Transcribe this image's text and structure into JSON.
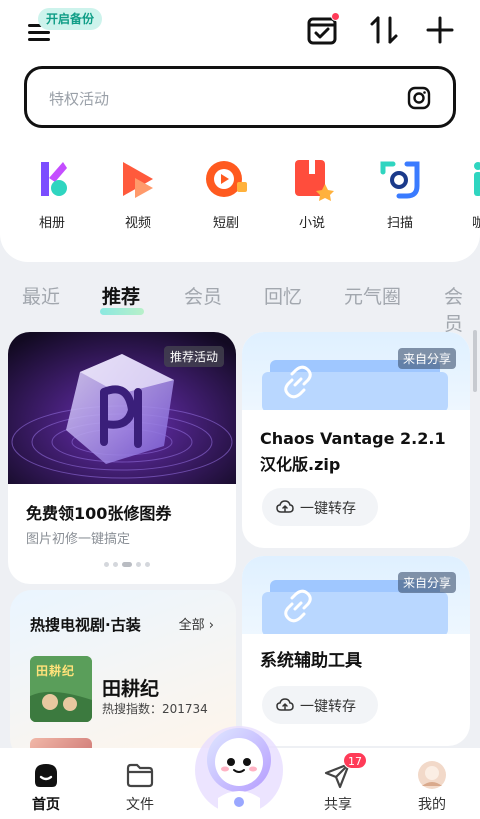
{
  "header": {
    "backup_label": "开启备份",
    "icons": [
      "menu-icon",
      "calendar-check-icon",
      "transfer-icon",
      "plus-icon"
    ]
  },
  "search": {
    "placeholder": "特权活动",
    "icon": "camera-icon"
  },
  "apps": [
    {
      "label": "相册",
      "icon": "album-icon"
    },
    {
      "label": "视频",
      "icon": "video-icon"
    },
    {
      "label": "短剧",
      "icon": "short-drama-icon"
    },
    {
      "label": "小说",
      "icon": "novel-icon"
    },
    {
      "label": "扫描",
      "icon": "scan-icon"
    },
    {
      "label": "咖",
      "icon": "partial-app-icon"
    }
  ],
  "tabs": [
    {
      "label": "最近"
    },
    {
      "label": "推荐"
    },
    {
      "label": "会员"
    },
    {
      "label": "回忆"
    },
    {
      "label": "元气圈"
    },
    {
      "label": "会员"
    }
  ],
  "feed": {
    "promo": {
      "tag": "推荐活动",
      "title": "免费领100张修图券",
      "subtitle": "图片初修一键搞定"
    },
    "share1": {
      "tag": "来自分享",
      "title": "Chaos Vantage 2.2.1 汉化版.zip",
      "button": "一键转存"
    },
    "share2": {
      "tag": "来自分享",
      "title": "系统辅助工具",
      "button": "一键转存"
    },
    "hot": {
      "title": "热搜电视剧·古装",
      "all_label": "全部",
      "drama_title": "田耕纪",
      "drama_index": "热搜指数：201734",
      "poster_text": "田耕纪"
    }
  },
  "nav": [
    {
      "label": "首页",
      "icon": "home-icon",
      "active": true
    },
    {
      "label": "文件",
      "icon": "folder-icon"
    },
    {
      "label": "共享",
      "icon": "send-icon",
      "badge": "17"
    },
    {
      "label": "我的",
      "icon": "avatar-icon"
    }
  ],
  "colors": {
    "accent": "#0f9d86",
    "badge": "#ff3b58",
    "tab_underline": "#8be8e0"
  }
}
